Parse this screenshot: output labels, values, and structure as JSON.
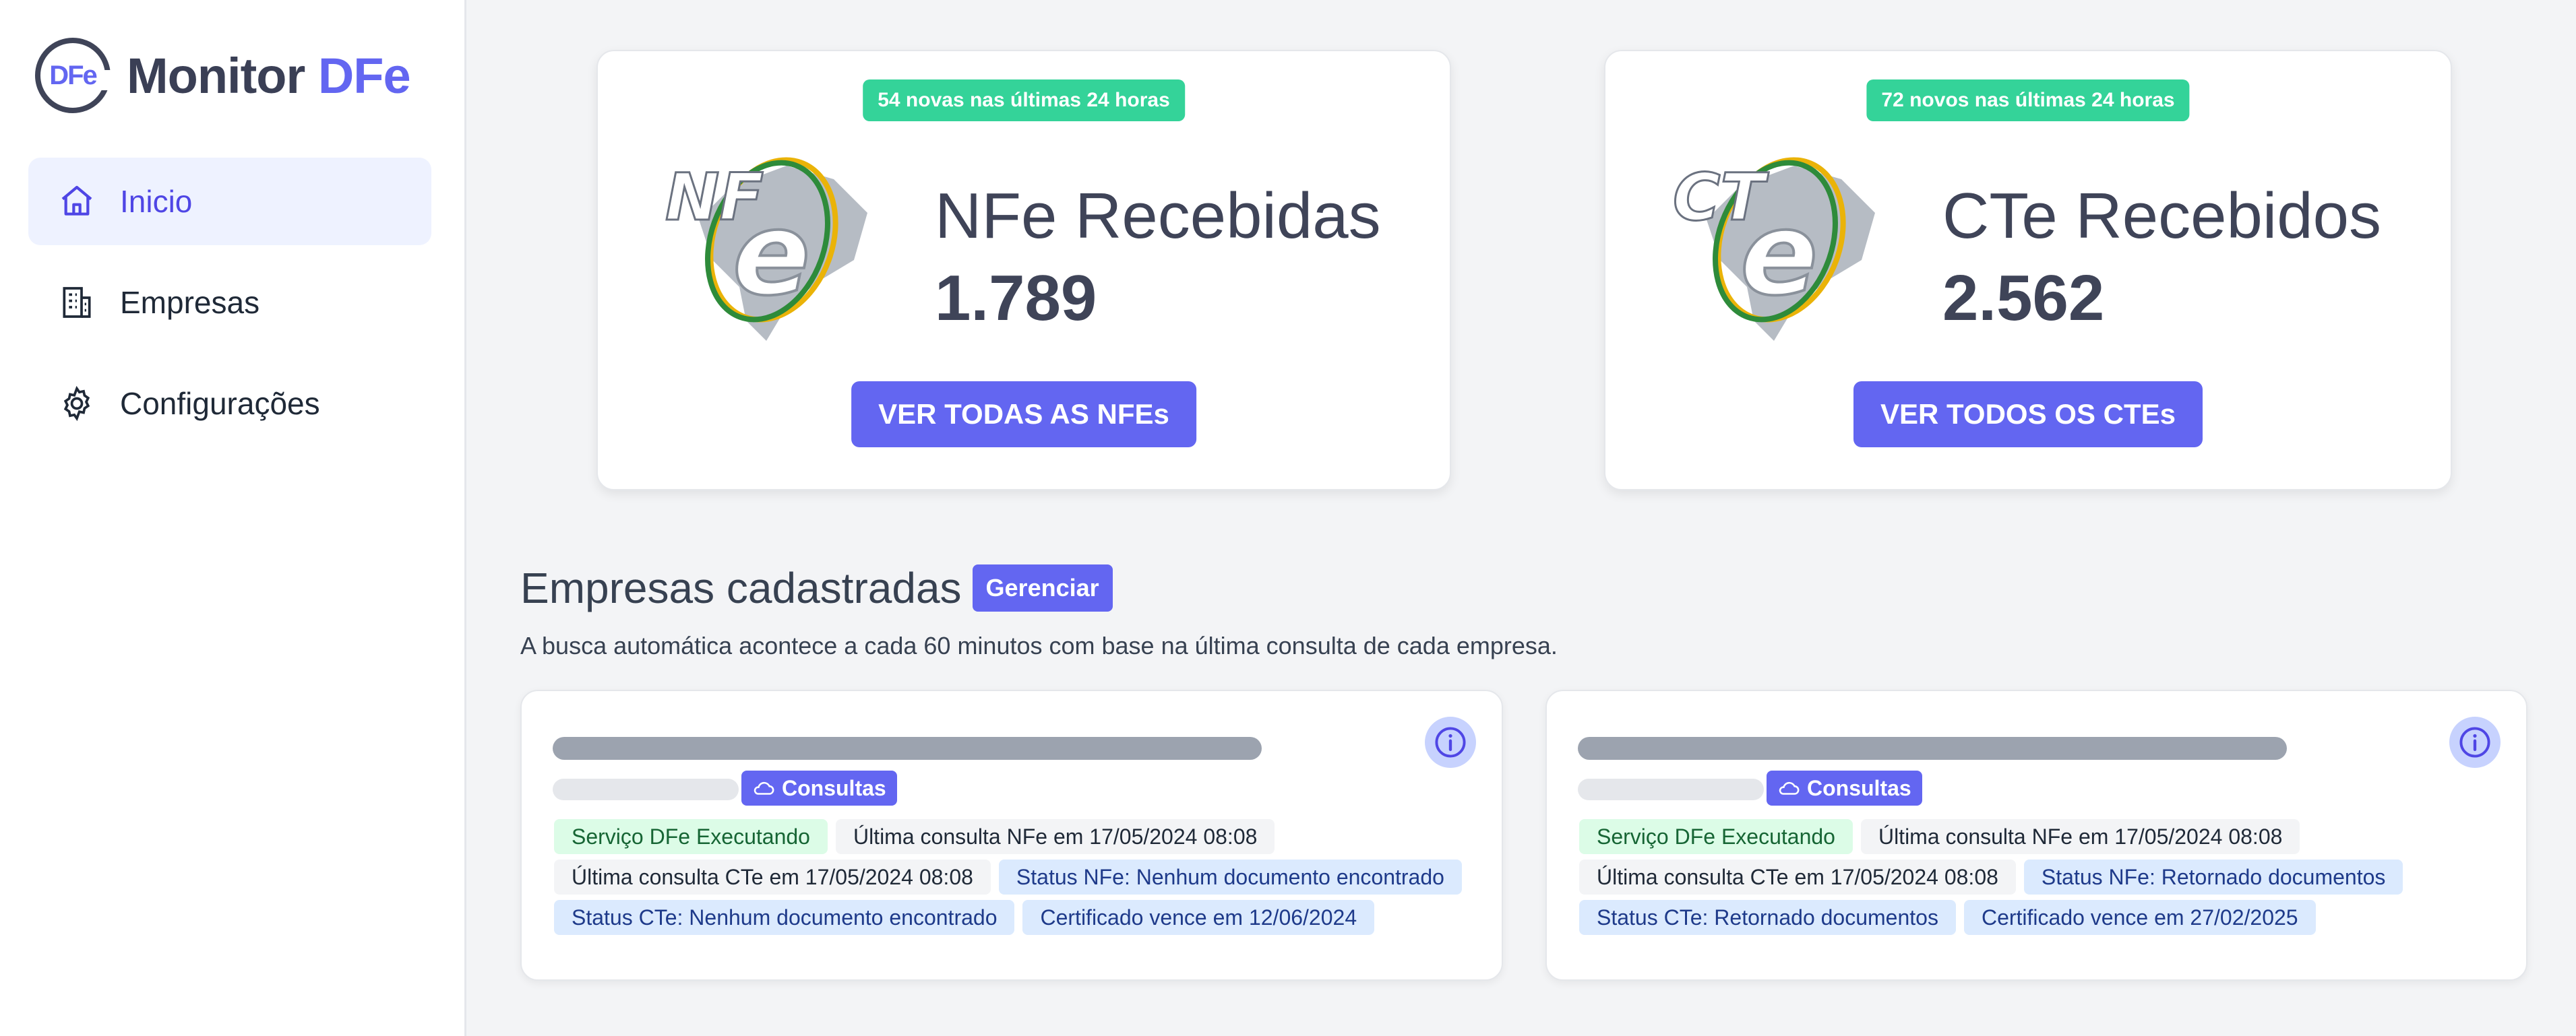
{
  "app": {
    "logo_mark": "DFe",
    "name_part1": "Monitor",
    "name_part2": "DFe"
  },
  "sidebar": {
    "items": [
      {
        "label": "Inicio",
        "icon": "home-icon",
        "active": true
      },
      {
        "label": "Empresas",
        "icon": "building-icon",
        "active": false
      },
      {
        "label": "Configurações",
        "icon": "gear-icon",
        "active": false
      }
    ]
  },
  "stats": {
    "nfe": {
      "badge": "54 novas nas últimas 24 horas",
      "logo_text": "NF",
      "logo_e": "e",
      "title": "NFe Recebidas",
      "value": "1.789",
      "button": "VER TODAS AS NFEs"
    },
    "cte": {
      "badge": "72 novos nas últimas 24 horas",
      "logo_text": "CT",
      "logo_e": "e",
      "title": "CTe Recebidos",
      "value": "2.562",
      "button": "VER TODOS OS CTEs"
    }
  },
  "companies_section": {
    "title": "Empresas cadastradas",
    "manage_button": "Gerenciar",
    "description": "A busca automática acontece a cada 60 minutos com base na última consulta de cada empresa."
  },
  "companies": [
    {
      "consultas_label": "Consultas",
      "tags": [
        {
          "text": "Serviço DFe Executando",
          "style": "green"
        },
        {
          "text": "Última consulta NFe em 17/05/2024 08:08",
          "style": "gray"
        },
        {
          "text": "Última consulta CTe em 17/05/2024 08:08",
          "style": "gray"
        },
        {
          "text": "Status NFe: Nenhum documento encontrado",
          "style": "blue"
        },
        {
          "text": "Status CTe: Nenhum documento encontrado",
          "style": "blue"
        },
        {
          "text": "Certificado vence em 12/06/2024",
          "style": "blue"
        }
      ]
    },
    {
      "consultas_label": "Consultas",
      "tags": [
        {
          "text": "Serviço DFe Executando",
          "style": "green"
        },
        {
          "text": "Última consulta NFe em 17/05/2024 08:08",
          "style": "gray"
        },
        {
          "text": "Última consulta CTe em 17/05/2024 08:08",
          "style": "gray"
        },
        {
          "text": "Status NFe: Retornado documentos",
          "style": "blue"
        },
        {
          "text": "Status CTe: Retornado documentos",
          "style": "blue"
        },
        {
          "text": "Certificado vence em 27/02/2025",
          "style": "blue"
        }
      ]
    }
  ],
  "colors": {
    "accent": "#6366f1",
    "success": "#34d399",
    "text_dark": "#3f4458"
  }
}
